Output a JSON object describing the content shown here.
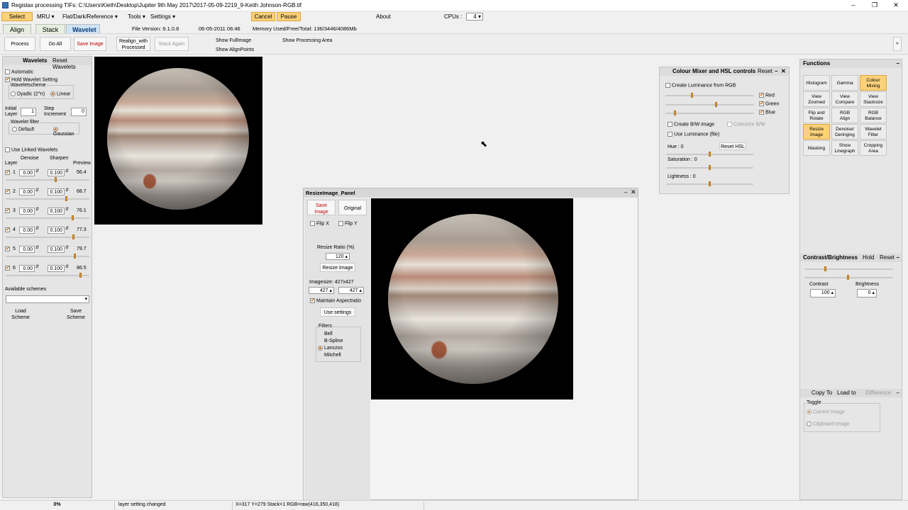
{
  "window": {
    "title": "Registax processing TIFs: C:\\Users\\Kieth\\Desktop\\Jupiter 9th May 2017\\2017-05-09-2219_9-Keith Johnson-RGB.tif"
  },
  "menu": {
    "select": "Select",
    "mru": "MRU",
    "flat": "Flat/Dark/Reference",
    "tools": "Tools",
    "settings": "Settings",
    "cancel": "Cancel",
    "pause": "Pause",
    "about": "About",
    "cpus_label": "CPUs :",
    "cpus_value": "4"
  },
  "tabs": {
    "align": "Align",
    "stack": "Stack",
    "wavelet": "Wavelet"
  },
  "info": {
    "file_version": "File Version: 6.1.0.8",
    "date": "06-05-2011 06:46",
    "memory": "Memory Used/Free/Total: 136/3446/4086Mb"
  },
  "toolbar": {
    "process": "Process",
    "do_all": "Do All",
    "save_image": "Save Image",
    "realign1": "Realign_with",
    "realign2": "Processed",
    "stack_again": "Stack Again",
    "show_full": "Show FullImage",
    "show_align": "Show AlignPoints",
    "show_area": "Show Processing Area"
  },
  "wavelets": {
    "title": "Wavelets",
    "reset": "Reset Wavelets",
    "automatic": "Automatic",
    "hold": "Hold Wavelet Setting",
    "scheme": "Waveletscheme",
    "dyadic": "Dyadic (2^n)",
    "linear": "Linear",
    "initial": "Initial",
    "layer": "Layer",
    "initial_value": "1",
    "step": "Step",
    "increment": "Increment",
    "step_value": "0",
    "filter": "Wavelet filter",
    "default": "Default",
    "gaussian": "Gaussian",
    "linked": "Use Linked Wavelets",
    "denoise": "Denoise",
    "sharpen": "Sharpen",
    "layer_col": "Layer",
    "preview": "Preview",
    "layers": [
      {
        "n": "1",
        "d": "0.00",
        "s": "0.100",
        "p": "56.4",
        "lvl": 0.62
      },
      {
        "n": "2",
        "d": "0.00",
        "s": "0.100",
        "p": "68.7",
        "lvl": 0.75
      },
      {
        "n": "3",
        "d": "0.00",
        "s": "0.100",
        "p": "76.1",
        "lvl": 0.83
      },
      {
        "n": "4",
        "d": "0.00",
        "s": "0.100",
        "p": "77.3",
        "lvl": 0.84
      },
      {
        "n": "5",
        "d": "0.00",
        "s": "0.100",
        "p": "79.7",
        "lvl": 0.86
      },
      {
        "n": "6",
        "d": "0.00",
        "s": "0.100",
        "p": "86.5",
        "lvl": 0.93
      }
    ],
    "available": "Available schemes",
    "load": "Load",
    "load2": "Scheme",
    "save": "Save",
    "save2": "Scheme"
  },
  "resize": {
    "title": "ResizeImage_Panel",
    "save1": "Save",
    "save2": "Image",
    "original": "Original",
    "flipx": "Flip X",
    "flipy": "Flip Y",
    "ratio_label": "Resize Ratio (%)",
    "ratio": "120",
    "resize_btn": "Resize Image",
    "imagesize": "Imagesize: 427x427",
    "w": "427",
    "h": "427",
    "maintain": "Maintain Aspectratio",
    "use_settings": "Use settings",
    "filters": "Filters",
    "filter_list": [
      "Bell",
      "B-Spline",
      "Lanczos",
      "Mitchell"
    ],
    "selected_filter": "Lanczos"
  },
  "mixer": {
    "title": "Colour Mixer and HSL controls",
    "reset": "Reset",
    "create_lum": "Create Luminance from RGB",
    "red": "Red",
    "green": "Green",
    "blue": "Blue",
    "red_lvl": 0.3,
    "green_lvl": 0.58,
    "blue_lvl": 0.1,
    "bw": "Create B/W image",
    "colourize": "Colourize B/W",
    "use_lum": "Use Luminance (file)",
    "hue": "Hue : 0",
    "reset_hsl": "Reset HSL",
    "saturation": "Saturation : 0",
    "lightness": "Lightness : 0"
  },
  "functions": {
    "title": "Functions",
    "buttons": [
      [
        "Histogram",
        ""
      ],
      [
        "Gamma",
        ""
      ],
      [
        "Colour",
        "Mixing"
      ],
      [
        "View",
        "Zoomed"
      ],
      [
        "View",
        "Compare"
      ],
      [
        "View",
        "Stacksize"
      ],
      [
        "Flip and",
        "Rotate"
      ],
      [
        "RGB",
        "Align"
      ],
      [
        "RGB",
        "Balance"
      ],
      [
        "Resize",
        "Image"
      ],
      [
        "Denoise/",
        "Deringing"
      ],
      [
        "Wavelet",
        "Filter"
      ],
      [
        "Masking",
        ""
      ],
      [
        "Show",
        "Linegraph"
      ],
      [
        "Cropping",
        "Area"
      ]
    ]
  },
  "contrast": {
    "title": "Contrast/Brightness",
    "hold": "Hold",
    "reset": "Reset",
    "contrast_label": "Contrast",
    "contrast_value": "100",
    "brightness_label": "Brightness",
    "brightness_value": "0"
  },
  "copyto": {
    "copy": "Copy To",
    "load": "Load to",
    "difference": "Difference",
    "toggle": "Toggle",
    "current": "Current Image",
    "clipboard": "Clipboard Image"
  },
  "status": {
    "progress": "0%",
    "message": "layer setting changed",
    "coords": "X=317 Y=279 Stack=1 RGB=raw(416,350,418)"
  }
}
